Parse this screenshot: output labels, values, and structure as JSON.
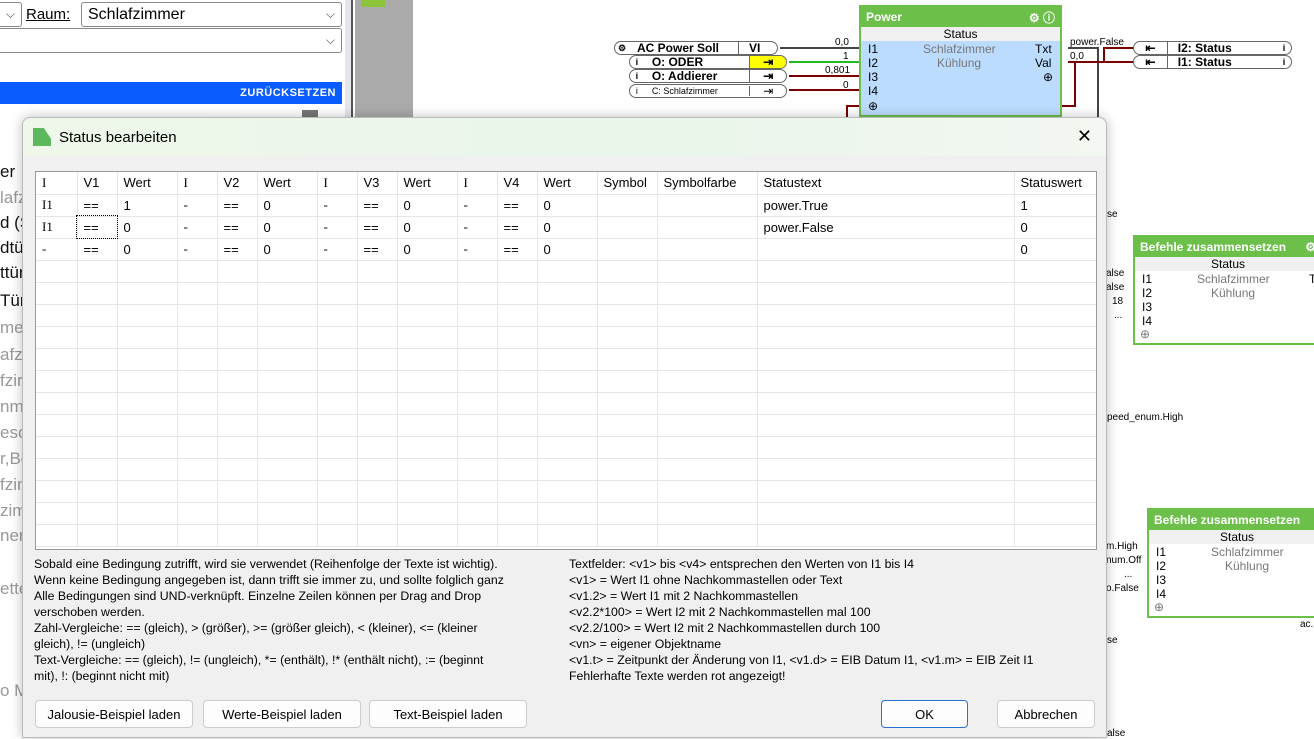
{
  "background": {
    "raum_label": "Raum:",
    "raum_value": "Schlafzimmer",
    "second_select": "",
    "reset_button": "ZURÜCKSETZEN",
    "side_fragments": [
      "er",
      "lafz",
      "d (S",
      "dtü",
      "ttür",
      "Tür",
      "mer",
      "afz",
      "fzir",
      "nm",
      "esc",
      "r,Be",
      "fzin",
      "zim",
      "ner",
      "ette",
      "o M"
    ]
  },
  "diagram": {
    "power_node": {
      "title": "Power",
      "subtitle": "Status",
      "label1": "Schlafzimmer",
      "label2": "Kühlung",
      "inputs": [
        "I1",
        "I2",
        "I3",
        "I4"
      ],
      "outputs": [
        "Txt",
        "Val"
      ],
      "in_values": [
        "0,0",
        "1",
        "0,801",
        "0"
      ],
      "out_values": [
        "power.False",
        "0,0"
      ]
    },
    "sources": [
      "AC Power Soll",
      "O: ODER",
      "O: Addierer",
      "C: Schlafzimmer"
    ],
    "source_vi": "VI",
    "targets": [
      "I2: Status",
      "I1: Status"
    ],
    "befehle1": {
      "title": "Befehle zusammensetzen",
      "subtitle": "Status",
      "label1": "Schlafzimmer",
      "label2": "Kühlung",
      "inputs": [
        "I1",
        "I2",
        "I3",
        "I4"
      ],
      "in_values": [
        "alse",
        "alse",
        "18",
        "..."
      ],
      "out_partial": "T"
    },
    "befehle2": {
      "title": "Befehle zusammensetzen",
      "subtitle": "Status",
      "label1": "Schlafzimmer",
      "label2": "Kühlung",
      "inputs": [
        "I1",
        "I2",
        "I3",
        "I4"
      ],
      "in_values": [
        "m.High",
        "num.Off",
        "...",
        "o.False"
      ],
      "below": "ac."
    },
    "stray_labels": [
      "se",
      "peed_enum.High",
      "se",
      "alse"
    ],
    "colors": {
      "node_green": "#6cc04a",
      "body_blue": "#bcdcff",
      "wire_red": "#7a0000",
      "wire_green": "#22bb22",
      "pin_orange": "#f0a848"
    }
  },
  "dialog": {
    "title": "Status bearbeiten",
    "columns": [
      "I",
      "V1",
      "Wert",
      "I",
      "V2",
      "Wert",
      "I",
      "V3",
      "Wert",
      "I",
      "V4",
      "Wert",
      "Symbol",
      "Symbolfarbe",
      "Statustext",
      "Statuswert"
    ],
    "rows": [
      [
        "I1",
        "==",
        "1",
        "-",
        "==",
        "0",
        "-",
        "==",
        "0",
        "-",
        "==",
        "0",
        "",
        "",
        "power.True",
        "1"
      ],
      [
        "I1",
        "==",
        "0",
        "-",
        "==",
        "0",
        "-",
        "==",
        "0",
        "-",
        "==",
        "0",
        "",
        "",
        "power.False",
        "0"
      ],
      [
        "-",
        "==",
        "0",
        "-",
        "==",
        "0",
        "-",
        "==",
        "0",
        "-",
        "==",
        "0",
        "",
        "",
        "",
        "0"
      ]
    ],
    "help_left": [
      "Sobald eine Bedingung zutrifft, wird sie verwendet (Reihenfolge der Texte ist wichtig).",
      "Wenn keine Bedingung angegeben ist, dann trifft sie immer zu, und sollte folglich ganz",
      "Alle Bedingungen sind UND-verknüpft. Einzelne Zeilen können per Drag and Drop",
      "verschoben werden.",
      "Zahl-Vergleiche: == (gleich), > (größer), >= (größer gleich), < (kleiner), <= (kleiner",
      "gleich), != (ungleich)",
      "Text-Vergleiche: == (gleich), != (ungleich), *= (enthält), !* (enthält nicht), := (beginnt",
      "mit), !: (beginnt nicht mit)"
    ],
    "help_right": [
      "Textfelder: <v1> bis <v4> entsprechen den Werten von I1 bis I4",
      "<v1> = Wert I1 ohne Nachkommastellen oder Text",
      "<v1.2> = Wert I1 mit 2 Nachkommastellen",
      "<v2.2*100> = Wert I2 mit 2 Nachkommastellen mal 100",
      "<v2.2/100> = Wert I2 mit 2 Nachkommastellen durch 100",
      "<vn> = eigener Objektname",
      "<v1.t> = Zeitpunkt der Änderung von I1, <v1.d> = EIB Datum I1, <v1.m> = EIB Zeit I1",
      "Fehlerhafte Texte werden rot angezeigt!"
    ],
    "buttons": {
      "jalousie": "Jalousie-Beispiel laden",
      "werte": "Werte-Beispiel laden",
      "text": "Text-Beispiel laden",
      "ok": "OK",
      "cancel": "Abbrechen"
    },
    "close_icon": "close-icon"
  }
}
